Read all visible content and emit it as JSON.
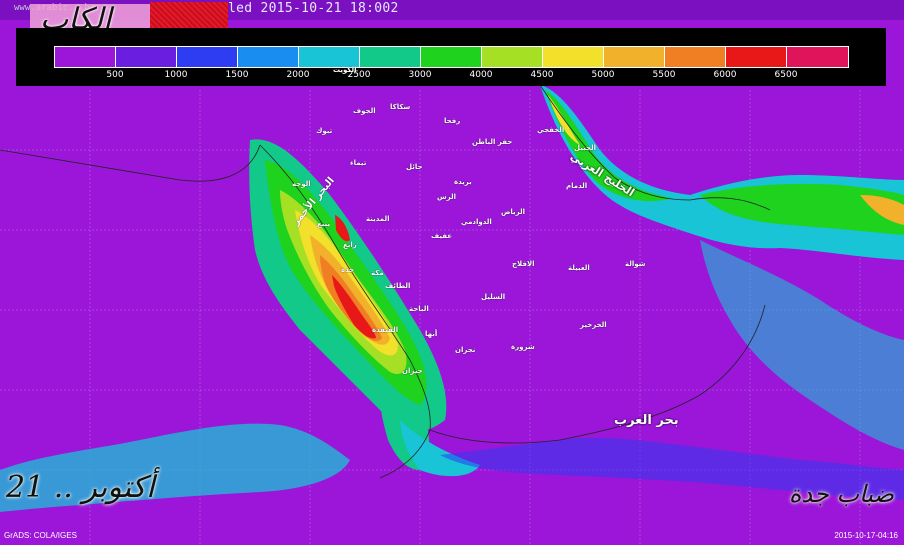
{
  "header": {
    "text": "led 2015-10-21 18:002",
    "watermark": "www.arabic...her.c",
    "logo_text": "الكاب"
  },
  "legend": {
    "colors": [
      "#9b16d8",
      "#6a1fe0",
      "#2e3cf2",
      "#1a8ef0",
      "#18c4d6",
      "#12c98a",
      "#1ed21e",
      "#a6e025",
      "#f2e02a",
      "#f2b12a",
      "#f07e22",
      "#e81818",
      "#e0145a"
    ],
    "labels": [
      "500",
      "1000",
      "1500",
      "2000",
      "2500",
      "3000",
      "4000",
      "4500",
      "5000",
      "5500",
      "6000",
      "6500"
    ]
  },
  "cities": [
    {
      "name": "الكويت",
      "key": "kuwait"
    },
    {
      "name": "حفر الباطن",
      "key": "hafr_albatin"
    },
    {
      "name": "سكاكا",
      "key": "sakaka"
    },
    {
      "name": "الجوف",
      "key": "aljouf"
    },
    {
      "name": "رفحا",
      "key": "rafha"
    },
    {
      "name": "تبوك",
      "key": "tabuk"
    },
    {
      "name": "تيماء",
      "key": "taima"
    },
    {
      "name": "حائل",
      "key": "hail"
    },
    {
      "name": "بريدة",
      "key": "buraidah"
    },
    {
      "name": "الرس",
      "key": "arrass"
    },
    {
      "name": "الدوادمي",
      "key": "dawadmi"
    },
    {
      "name": "الرياض",
      "key": "riyadh"
    },
    {
      "name": "عفيف",
      "key": "afif"
    },
    {
      "name": "المدينة",
      "key": "madinah"
    },
    {
      "name": "ينبع",
      "key": "yanbu"
    },
    {
      "name": "الوجه",
      "key": "alwajh"
    },
    {
      "name": "مكة",
      "key": "makkah"
    },
    {
      "name": "جدة",
      "key": "jeddah"
    },
    {
      "name": "الطائف",
      "key": "taif"
    },
    {
      "name": "الباحة",
      "key": "albaha"
    },
    {
      "name": "القنفذة",
      "key": "qunfudah"
    },
    {
      "name": "أبها",
      "key": "abha"
    },
    {
      "name": "نجران",
      "key": "najran"
    },
    {
      "name": "جيزان",
      "key": "jizan"
    },
    {
      "name": "شرورة",
      "key": "sharurah"
    },
    {
      "name": "السليل",
      "key": "sulayyil"
    },
    {
      "name": "الافلاج",
      "key": "aflaj"
    },
    {
      "name": "الخرخير",
      "key": "kharkhir"
    },
    {
      "name": "العبيلة",
      "key": "ubaylah"
    },
    {
      "name": "شوالة",
      "key": "shawalah"
    },
    {
      "name": "الدمام",
      "key": "dammam"
    },
    {
      "name": "الجبيل",
      "key": "jubail"
    },
    {
      "name": "الخفجي",
      "key": "khafji"
    },
    {
      "name": "رابغ",
      "key": "rabigh"
    }
  ],
  "seas": {
    "arabian_sea": "بحر العرب",
    "arabian_gulf": "الخليج العربي",
    "red_sea": "البحر الأحمر"
  },
  "captions": {
    "date": "21 .. أكتوبر",
    "fog": "ضباب جدة",
    "credit": "GrADS: COLA/IGES",
    "timestamp": "2015-10-17-04:16"
  }
}
